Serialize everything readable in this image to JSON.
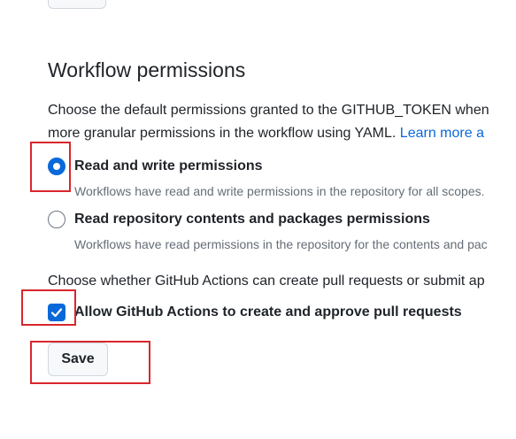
{
  "section": {
    "title": "Workflow permissions",
    "description_line1": "Choose the default permissions granted to the GITHUB_TOKEN when",
    "description_line2": "more granular permissions in the workflow using YAML. ",
    "learn_more": "Learn more a"
  },
  "permissions": {
    "options": [
      {
        "label": "Read and write permissions",
        "help": "Workflows have read and write permissions in the repository for all scopes.",
        "selected": true
      },
      {
        "label": "Read repository contents and packages permissions",
        "help": "Workflows have read permissions in the repository for the contents and pac",
        "selected": false
      }
    ]
  },
  "pull_requests": {
    "description": "Choose whether GitHub Actions can create pull requests or submit ap",
    "checkbox_label": "Allow GitHub Actions to create and approve pull requests",
    "checked": true
  },
  "save": {
    "label": "Save"
  },
  "colors": {
    "accent": "#0969da",
    "highlight": "#d9262d",
    "text": "#1f2328",
    "muted": "#656d76"
  }
}
